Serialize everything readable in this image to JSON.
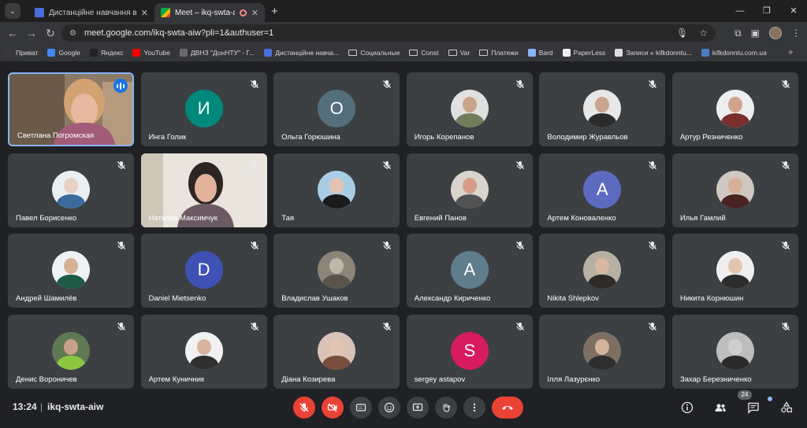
{
  "tabs": [
    {
      "title": "Дистанційне навчання в ВСП",
      "favicon_color": "#4a6ee0"
    },
    {
      "title": "Meet – ikq-swta-aiw",
      "favicon_color": "#00ac47"
    }
  ],
  "new_tab": "+",
  "window_controls": [
    "—",
    "❐",
    "✕"
  ],
  "address": {
    "url": "meet.google.com/ikq-swta-aiw?pli=1&authuser=1"
  },
  "bookmarks": [
    {
      "label": "Приват",
      "icon_color": "#3a3a3a",
      "folder": false
    },
    {
      "label": "Google",
      "icon_color": "#4285f4",
      "folder": false
    },
    {
      "label": "Яндекс",
      "icon_color": "#222222",
      "folder": false
    },
    {
      "label": "YouTube",
      "icon_color": "#ff0000",
      "folder": false
    },
    {
      "label": "ДВНЗ \"ДонНТУ\" - Г...",
      "icon_color": "#6a6a6a",
      "folder": false
    },
    {
      "label": "Дистанційне навча...",
      "icon_color": "#4a6ee0",
      "folder": false
    },
    {
      "label": "Социальные",
      "icon_color": "",
      "folder": true
    },
    {
      "label": "Const",
      "icon_color": "",
      "folder": true
    },
    {
      "label": "Var",
      "icon_color": "",
      "folder": true
    },
    {
      "label": "Платежи",
      "icon_color": "",
      "folder": true
    },
    {
      "label": "Bard",
      "icon_color": "#8ab4f8",
      "folder": false
    },
    {
      "label": "PaperLess",
      "icon_color": "#eeeeee",
      "folder": false
    },
    {
      "label": "Записи « kifkdonntu...",
      "icon_color": "#dddddd",
      "folder": false
    },
    {
      "label": "kifkdonntu.com.ua",
      "icon_color": "#4e7cc2",
      "folder": false
    }
  ],
  "participants": [
    {
      "name": "Светлана Погромская",
      "type": "video",
      "active": true
    },
    {
      "name": "Инга Голик",
      "type": "letter",
      "letter": "И",
      "color": "#00897b"
    },
    {
      "name": "Ольга Горюшина",
      "type": "letter",
      "letter": "О",
      "color": "#546e7a"
    },
    {
      "name": "Игорь Корепанов",
      "type": "photo",
      "bg": "#e0e0e0",
      "skin": "#c9a48a",
      "shirt": "#6f7d5b"
    },
    {
      "name": "Володимир Журавльов",
      "type": "photo",
      "bg": "#e7e7e7",
      "skin": "#caa48c",
      "shirt": "#2b2b2b"
    },
    {
      "name": "Артур Резниченко",
      "type": "photo",
      "bg": "#eeeeee",
      "skin": "#d3a28e",
      "shirt": "#7a2e2e"
    },
    {
      "name": "Павел Борисенко",
      "type": "photo",
      "bg": "#e8f0f4",
      "skin": "#e8d0c4",
      "shirt": "#3b6a9c"
    },
    {
      "name": "Наталка Максимчук",
      "type": "video2"
    },
    {
      "name": "Тая",
      "type": "photo",
      "bg": "#a9cde3",
      "skin": "#e5c3b4",
      "shirt": "#1a1a1a"
    },
    {
      "name": "Евгений Панов",
      "type": "photo",
      "bg": "#d9d4cc",
      "skin": "#d49c86",
      "shirt": "#525252"
    },
    {
      "name": "Артем Коноваленко",
      "type": "letter",
      "letter": "А",
      "color": "#5c6bc0"
    },
    {
      "name": "Илья Гамлий",
      "type": "photo",
      "bg": "#cfc8c0",
      "skin": "#d8b09a",
      "shirt": "#4a2222"
    },
    {
      "name": "Андрей Шамилёв",
      "type": "photo",
      "bg": "#eef2f2",
      "skin": "#d6b097",
      "shirt": "#1c5a45"
    },
    {
      "name": "Daniel Mietsenko",
      "type": "letter",
      "letter": "D",
      "color": "#3f51b5"
    },
    {
      "name": "Владислав Ушаков",
      "type": "photo",
      "bg": "#8d8478",
      "skin": "#bdb6ad",
      "shirt": "#5a544c"
    },
    {
      "name": "Александр Кириченко",
      "type": "letter",
      "letter": "А",
      "color": "#607d8b"
    },
    {
      "name": "Nikita Shlepkov",
      "type": "photo",
      "bg": "#b9b0a4",
      "skin": "#d8b8a0",
      "shirt": "#2e2a27"
    },
    {
      "name": "Никита Корнюшин",
      "type": "photo",
      "bg": "#efefef",
      "skin": "#e2c6b0",
      "shirt": "#2c2c2c"
    },
    {
      "name": "Денис Вороничев",
      "type": "photo",
      "bg": "#5f7a52",
      "skin": "#c9a088",
      "shirt": "#8cc63f"
    },
    {
      "name": "Артем Куничник",
      "type": "photo",
      "bg": "#f1f1f1",
      "skin": "#d8b49f",
      "shirt": "#2f2f2f"
    },
    {
      "name": "Діана Козирева",
      "type": "photo",
      "bg": "#d9c3b8",
      "skin": "#e6c4b2",
      "shirt": "#7a4e3c"
    },
    {
      "name": "sergey astapov",
      "type": "letter",
      "letter": "S",
      "color": "#d81b60"
    },
    {
      "name": "Ілля Лазурєнко",
      "type": "photo",
      "bg": "#7d7062",
      "skin": "#d5b49c",
      "shirt": "#2e2e2e"
    },
    {
      "name": "Захар Березниченко",
      "type": "photo",
      "bg": "#bdbdbd",
      "skin": "#cfcfcf",
      "shirt": "#2a2a2a"
    }
  ],
  "bottom": {
    "time": "13:24",
    "separator": "|",
    "meeting_code": "ikq-swta-aiw",
    "participant_count": "24"
  },
  "colors": {
    "tile_bg": "#3c4043",
    "stage_bg": "#202124",
    "accent": "#8ab4f8",
    "danger": "#ea4335"
  }
}
